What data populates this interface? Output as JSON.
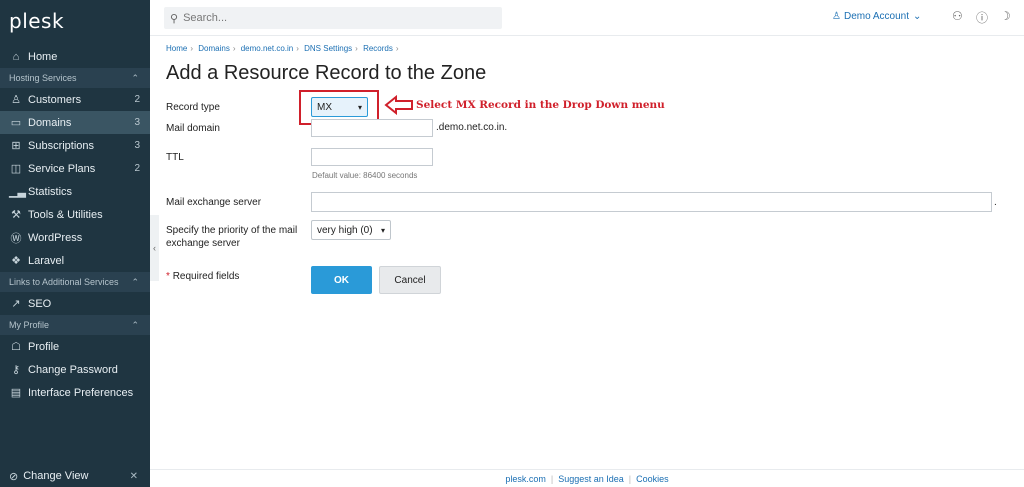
{
  "app": {
    "logo": "plesk"
  },
  "topbar": {
    "search_placeholder": "Search...",
    "account_label": "Demo Account",
    "account_chevron": "⌄"
  },
  "sidebar": {
    "home": "Home",
    "hosting_section": "Hosting Services",
    "items": [
      {
        "label": "Customers",
        "count": "2",
        "icon": "user-icon"
      },
      {
        "label": "Domains",
        "count": "3",
        "icon": "monitor-icon",
        "active": true
      },
      {
        "label": "Subscriptions",
        "count": "3",
        "icon": "grid-icon"
      },
      {
        "label": "Service Plans",
        "count": "2",
        "icon": "book-icon"
      },
      {
        "label": "Statistics",
        "count": "",
        "icon": "bar-chart-icon"
      },
      {
        "label": "Tools & Utilities",
        "count": "",
        "icon": "tools-icon"
      },
      {
        "label": "WordPress",
        "count": "",
        "icon": "wordpress-icon"
      },
      {
        "label": "Laravel",
        "count": "",
        "icon": "laravel-icon"
      }
    ],
    "links_section": "Links to Additional Services",
    "seo": "SEO",
    "profile_section": "My Profile",
    "profile": "Profile",
    "change_password": "Change Password",
    "interface_preferences": "Interface Preferences",
    "change_view": "Change View"
  },
  "main": {
    "breadcrumb": [
      "Home",
      "Domains",
      "demo.net.co.in",
      "DNS Settings",
      "Records"
    ],
    "title": "Add a Resource Record to the Zone",
    "record_type_label": "Record type",
    "record_type_value": "MX",
    "annotation": "Select MX Record in the Drop Down menu",
    "mail_domain_label": "Mail domain",
    "mail_domain_value": "",
    "mail_domain_suffix": ".demo.net.co.in.",
    "ttl_label": "TTL",
    "ttl_value": "",
    "ttl_hint": "Default value: 86400 seconds",
    "mx_server_label": "Mail exchange server",
    "mx_server_value": "",
    "mx_server_suffix": ".",
    "priority_label": "Specify the priority of the mail exchange server",
    "priority_value": "very high (0)",
    "required_star": "*",
    "required_label": "Required fields",
    "ok_label": "OK",
    "cancel_label": "Cancel"
  },
  "footer": {
    "links": [
      "plesk.com",
      "Suggest an Idea",
      "Cookies"
    ]
  },
  "colors": {
    "sidebar_bg": "#1f3541",
    "accent": "#2a9ad8",
    "link": "#1b6fb3",
    "annotation": "#d0202b"
  }
}
